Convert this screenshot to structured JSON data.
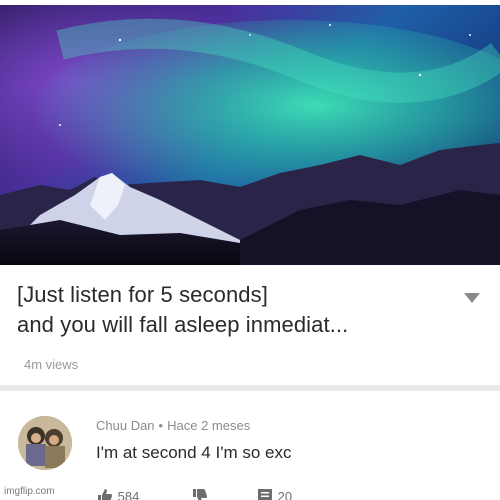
{
  "video": {
    "title": "[Just listen for 5 seconds]\nand you will fall asleep inmediat...",
    "views": "4m views"
  },
  "comment": {
    "author": "Chuu Dan",
    "separator": "•",
    "time": "Hace 2 meses",
    "text": "I'm at second 4 I'm so exc",
    "likes": "584",
    "replies": "20"
  },
  "watermark": "imgflip.com",
  "icons": {
    "expand": "chevron-down-icon",
    "like": "thumbs-up-icon",
    "dislike": "thumbs-down-icon",
    "reply": "comment-icon"
  },
  "colors": {
    "aurora_green": "#2fd6a8",
    "aurora_purple": "#6a3fb8",
    "title_text": "#2a2a2a",
    "meta_text": "#8c8c8c"
  }
}
